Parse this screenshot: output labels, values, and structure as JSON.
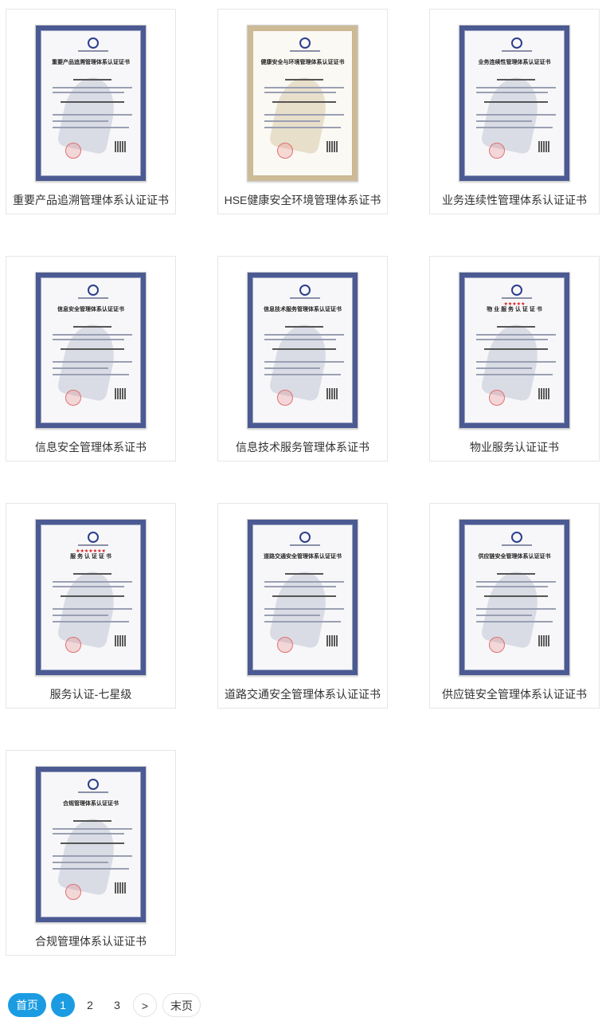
{
  "certificates": [
    {
      "caption": "重要产品追溯管理体系认证证书",
      "cert_title": "重要产品追溯管理体系认证证书",
      "style": "blue",
      "stars": ""
    },
    {
      "caption": "HSE健康安全环境管理体系证书",
      "cert_title": "健康安全与环境管理体系认证证书",
      "style": "gold",
      "stars": ""
    },
    {
      "caption": "业务连续性管理体系认证证书",
      "cert_title": "业务连续性管理体系认证证书",
      "style": "blue",
      "stars": ""
    },
    {
      "caption": "信息安全管理体系证书",
      "cert_title": "信息安全管理体系认证证书",
      "style": "blue",
      "stars": ""
    },
    {
      "caption": "信息技术服务管理体系证书",
      "cert_title": "信息技术服务管理体系认证证书",
      "style": "blue",
      "stars": ""
    },
    {
      "caption": "物业服务认证证书",
      "cert_title": "物 业 服 务 认 证 证 书",
      "style": "blue",
      "stars": "★★★★★"
    },
    {
      "caption": "服务认证-七星级",
      "cert_title": "服 务 认 证 证 书",
      "style": "blue",
      "stars": "★★★★★★★"
    },
    {
      "caption": "道路交通安全管理体系认证证书",
      "cert_title": "道路交通安全管理体系认证证书",
      "style": "blue",
      "stars": ""
    },
    {
      "caption": "供应链安全管理体系认证证书",
      "cert_title": "供应链安全管理体系认证证书",
      "style": "blue",
      "stars": ""
    },
    {
      "caption": "合规管理体系认证证书",
      "cert_title": "合规管理体系认证证书",
      "style": "blue",
      "stars": ""
    }
  ],
  "pagination": {
    "first": "首页",
    "pages": [
      "1",
      "2",
      "3"
    ],
    "next": ">",
    "last": "末页",
    "current": "1"
  },
  "colors": {
    "accent": "#1b9ce2",
    "border": "#e6e6e6",
    "text": "#333333"
  }
}
